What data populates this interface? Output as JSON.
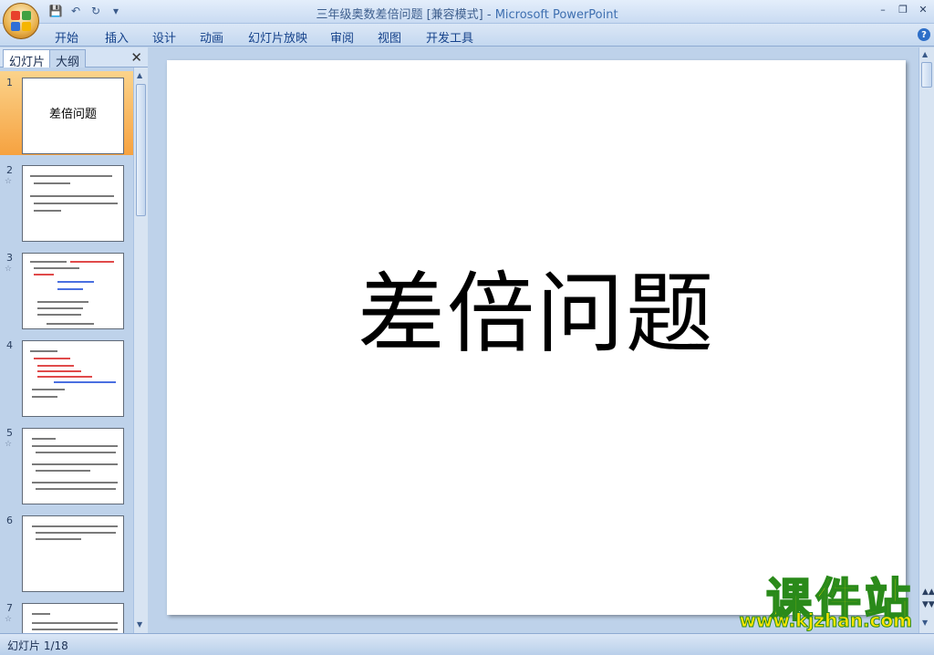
{
  "window": {
    "doc_title": "三年级奥数差倍问题 [兼容模式]",
    "separator": " - ",
    "app_name": "Microsoft PowerPoint"
  },
  "ribbon": {
    "tabs": [
      "开始",
      "插入",
      "设计",
      "动画",
      "幻灯片放映",
      "审阅",
      "视图",
      "开发工具"
    ]
  },
  "left_panel": {
    "tab_slides": "幻灯片",
    "tab_outline": "大纲",
    "slides": [
      {
        "num": "1",
        "title": "差倍问题",
        "selected": true
      },
      {
        "num": "2"
      },
      {
        "num": "3"
      },
      {
        "num": "4"
      },
      {
        "num": "5"
      },
      {
        "num": "6"
      },
      {
        "num": "7"
      }
    ]
  },
  "slide": {
    "title": "差倍问题"
  },
  "status": {
    "slide_indicator": "幻灯片 1/18"
  },
  "watermark": {
    "cn": "课件站",
    "url": "www.kjzhan.com"
  },
  "colors": {
    "office_logo": [
      "#e8412c",
      "#3fa142",
      "#2f6fd6",
      "#f5b500"
    ]
  }
}
